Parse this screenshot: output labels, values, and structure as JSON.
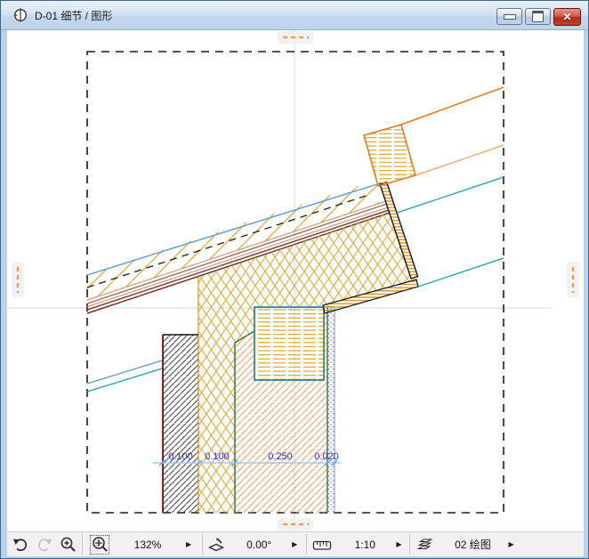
{
  "window": {
    "title": "D-01 细节 / 图形"
  },
  "toolbar": {
    "zoom_level": "132%",
    "rotation_angle": "0.00°",
    "drawing_scale": "1:10",
    "active_layer": "02 绘图",
    "icons": {
      "previous_view": "curved-back-arrow",
      "next_view": "curved-forward-arrow",
      "zoom_in": "magnifier-plus",
      "fit_in_window": "magnifier-fit-active",
      "orientation": "tilted-plane-pencil",
      "scale": "ruler",
      "layer": "stacked-layers"
    }
  },
  "drawing": {
    "dimension_labels": [
      "0.100",
      "0.100",
      "0.250",
      "0.020"
    ],
    "colors": {
      "rafter_orange": "#e8791e",
      "hatch_gold": "#d9a42c",
      "membrane_brown": "#9b6450",
      "line_teal": "#12a5a5",
      "line_blue": "#5b9bd5",
      "wall_border_green": "#2d6e3a",
      "wall_edge_maroon": "#7d1f1f",
      "plaster_dot_blue": "#7b8cc8",
      "dimension_text_blue": "#2b2bd2",
      "dimension_line_blue": "#8fc3ec",
      "boundary_handle_orange": "#f0995a",
      "frame_blue": "#b9d1ea"
    }
  }
}
